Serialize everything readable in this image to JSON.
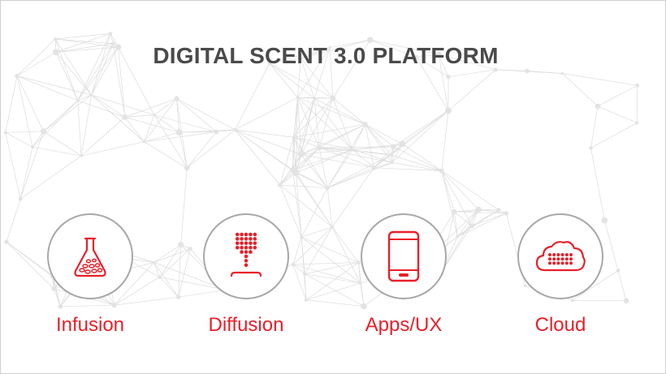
{
  "slide": {
    "title": "DIGITAL SCENT 3.0 PLATFORM"
  },
  "pillars": [
    {
      "label": "Infusion",
      "icon": "flask-icon"
    },
    {
      "label": "Diffusion",
      "icon": "diffuser-icon"
    },
    {
      "label": "Apps/UX",
      "icon": "smartphone-icon"
    },
    {
      "label": "Cloud",
      "icon": "cloud-icon"
    }
  ],
  "colors": {
    "accent": "#e8202a",
    "title": "#4a4a4a",
    "circle_border": "#a8a8a8",
    "network": "#d9d9d9"
  }
}
